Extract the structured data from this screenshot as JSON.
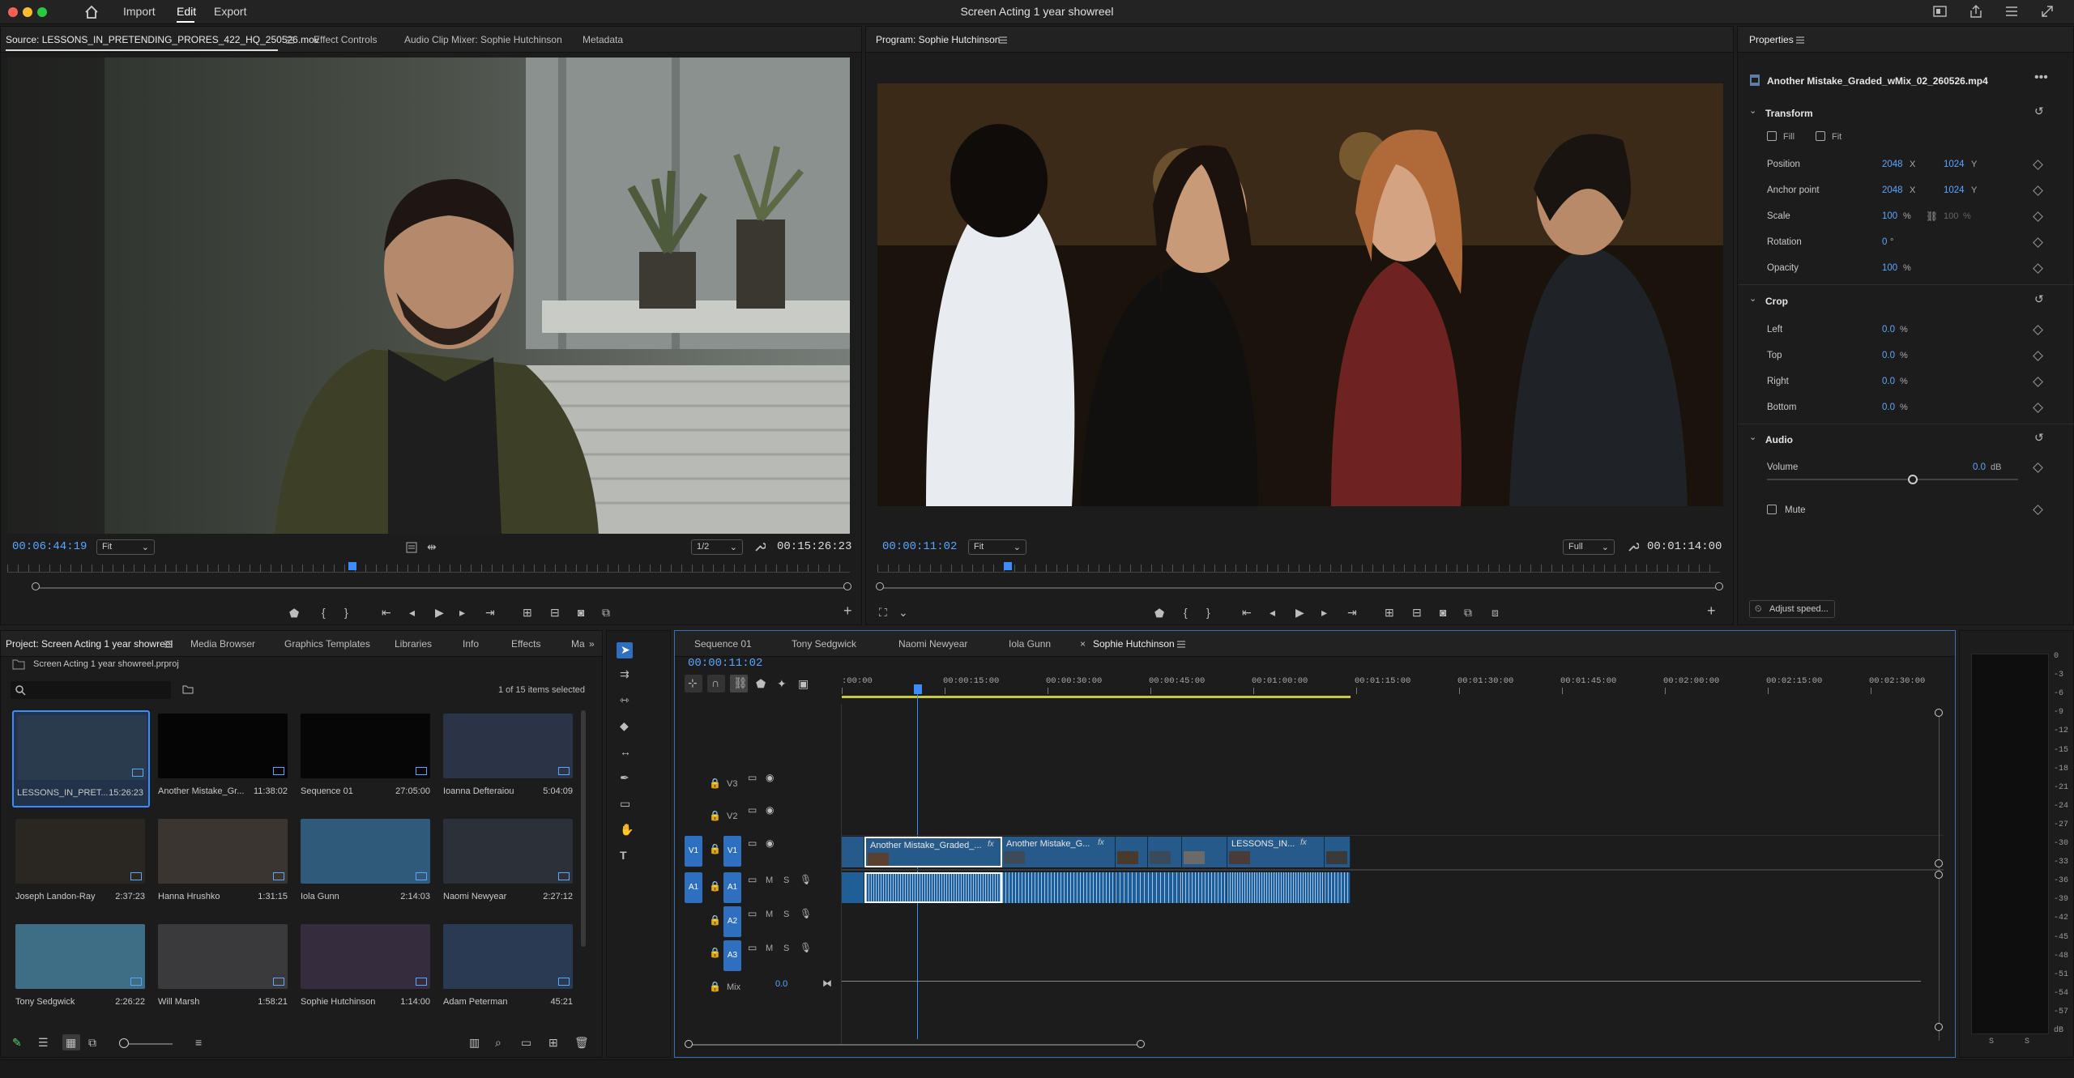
{
  "menu": {
    "import": "Import",
    "edit": "Edit",
    "export": "Export"
  },
  "window_title": "Screen Acting 1 year showreel",
  "source": {
    "tabs": [
      "Source: LESSONS_IN_PRETENDING_PRORES_422_HQ_250526.mov",
      "Effect Controls",
      "Audio Clip Mixer: Sophie Hutchinson",
      "Metadata"
    ],
    "timecode": "00:06:44:19",
    "zoom": "Fit",
    "resolution": "1/2",
    "duration": "00:15:26:23",
    "playhead_fraction": 0.405
  },
  "program": {
    "tab": "Program: Sophie Hutchinson",
    "timecode": "00:00:11:02",
    "zoom": "Fit",
    "resolution": "Full",
    "duration": "00:01:14:00",
    "playhead_fraction": 0.15
  },
  "properties": {
    "title": "Properties",
    "file": "Another Mistake_Graded_wMix_02_260526.mp4",
    "transform": {
      "title": "Transform",
      "fill": "Fill",
      "fit": "Fit",
      "rows": [
        {
          "label": "Position",
          "v1": "2048",
          "u1": "X",
          "v2": "1024",
          "u2": "Y"
        },
        {
          "label": "Anchor point",
          "v1": "2048",
          "u1": "X",
          "v2": "1024",
          "u2": "Y"
        },
        {
          "label": "Scale",
          "v1": "100",
          "u1": "%",
          "v2": "100",
          "u2": "%"
        },
        {
          "label": "Rotation",
          "v1": "0",
          "u1": "°",
          "v2": "",
          "u2": ""
        },
        {
          "label": "Opacity",
          "v1": "100",
          "u1": "%",
          "v2": "",
          "u2": ""
        }
      ]
    },
    "crop": {
      "title": "Crop",
      "rows": [
        {
          "label": "Left",
          "v": "0.0",
          "u": "%"
        },
        {
          "label": "Top",
          "v": "0.0",
          "u": "%"
        },
        {
          "label": "Right",
          "v": "0.0",
          "u": "%"
        },
        {
          "label": "Bottom",
          "v": "0.0",
          "u": "%"
        }
      ]
    },
    "audio": {
      "title": "Audio",
      "volume_label": "Volume",
      "volume_value": "0.0",
      "volume_unit": "dB",
      "mute": "Mute"
    },
    "adjust_speed": "Adjust speed..."
  },
  "project": {
    "tabs": [
      "Project: Screen Acting 1 year showreel",
      "Media Browser",
      "Graphics Templates",
      "Libraries",
      "Info",
      "Effects",
      "Ma"
    ],
    "file": "Screen Acting 1 year showreel.prproj",
    "selection": "1 of 15 items selected",
    "items": [
      {
        "name": "LESSONS_IN_PRET...",
        "dur": "15:26:23",
        "color": "#2b3b4e"
      },
      {
        "name": "Another Mistake_Gr...",
        "dur": "11:38:02",
        "color": "#050505"
      },
      {
        "name": "Sequence 01",
        "dur": "27:05:00",
        "color": "#060606"
      },
      {
        "name": "Ioanna Defteraiou",
        "dur": "5:04:09",
        "color": "#2a3446"
      },
      {
        "name": "Joseph Landon-Ray",
        "dur": "2:37:23",
        "color": "#2a2622"
      },
      {
        "name": "Hanna Hrushko",
        "dur": "1:31:15",
        "color": "#3a3530"
      },
      {
        "name": "Iola Gunn",
        "dur": "2:14:03",
        "color": "#2f5a7a"
      },
      {
        "name": "Naomi Newyear",
        "dur": "2:27:12",
        "color": "#2c3038"
      },
      {
        "name": "Tony Sedgwick",
        "dur": "2:26:22",
        "color": "#3e6e86"
      },
      {
        "name": "Will Marsh",
        "dur": "1:58:21",
        "color": "#3a3a3c"
      },
      {
        "name": "Sophie Hutchinson",
        "dur": "1:14:00",
        "color": "#352d3e"
      },
      {
        "name": "Adam Peterman",
        "dur": "45:21",
        "color": "#2a3a52"
      }
    ]
  },
  "timeline": {
    "tabs": [
      "Sequence 01",
      "Tony Sedgwick",
      "Naomi Newyear",
      "Iola Gunn",
      "Sophie Hutchinson"
    ],
    "active_tab_index": 4,
    "timecode": "00:00:11:02",
    "ruler": [
      ":00:00",
      "00:00:15:00",
      "00:00:30:00",
      "00:00:45:00",
      "00:01:00:00",
      "00:01:15:00",
      "00:01:30:00",
      "00:01:45:00",
      "00:02:00:00",
      "00:02:15:00",
      "00:02:30:00"
    ],
    "tracks": {
      "v3": "V3",
      "v2": "V2",
      "v1": "V1",
      "a1": "A1",
      "a2": "A2",
      "a3": "A3",
      "mix": "Mix",
      "mix_value": "0.0",
      "m": "M",
      "s": "S"
    },
    "clips": [
      "Another Mistake_Graded_...",
      "Another Mistake_G...",
      "LESSONS_IN..."
    ],
    "fx": "fx"
  },
  "meter": {
    "scale": [
      "0",
      "-3",
      "-6",
      "-9",
      "-12",
      "-15",
      "-18",
      "-21",
      "-24",
      "-27",
      "-30",
      "-33",
      "-36",
      "-39",
      "-42",
      "-45",
      "-48",
      "-51",
      "-54",
      "-57",
      "dB"
    ],
    "s1": "S",
    "s2": "S"
  }
}
